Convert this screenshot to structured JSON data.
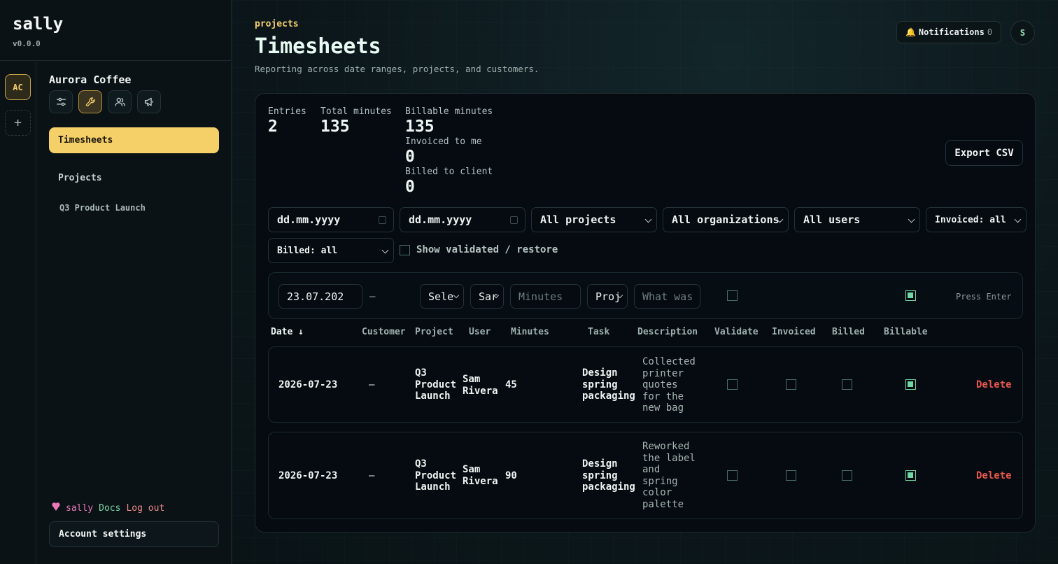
{
  "brand": {
    "name": "sally",
    "version": "v0.0.0"
  },
  "rail": {
    "org_initials": "AC",
    "add_label": "+"
  },
  "sidebar": {
    "org_name": "Aurora Coffee",
    "nav": {
      "timesheets": "Timesheets",
      "projects": "Projects",
      "project_sub": "Q3 Product Launch"
    },
    "footer": {
      "sally": "sally",
      "docs": "Docs",
      "logout": "Log out"
    },
    "account": "Account settings"
  },
  "header": {
    "crumb": "projects",
    "title": "Timesheets",
    "subtitle": "Reporting across date ranges, projects, and customers.",
    "notifications_label": "Notifications",
    "notifications_count": "0",
    "avatar_initial": "S"
  },
  "stats": {
    "entries_label": "Entries",
    "entries_value": "2",
    "total_label": "Total minutes",
    "total_value": "135",
    "billable_label": "Billable minutes",
    "billable_value": "135",
    "invoiced_label": "Invoiced to me",
    "invoiced_value": "0",
    "billed_label": "Billed to client",
    "billed_value": "0"
  },
  "export_label": "Export CSV",
  "filters": {
    "from_date": "dd.mm.yyyy",
    "to_date": "dd.mm.yyyy",
    "project": "All projects",
    "organization": "All organizations",
    "user": "All users",
    "invoiced": "Invoiced: all",
    "billed": "Billed: all",
    "show_validated": "Show validated / restore"
  },
  "entry": {
    "date": "23.07.202",
    "dash": "–",
    "customer": "Sele",
    "user": "Sar",
    "minutes_placeholder": "Minutes",
    "project": "Proj",
    "description_placeholder": "What was",
    "hint": "Press Enter"
  },
  "columns": {
    "date": "Date ↓",
    "customer": "Customer",
    "project": "Project",
    "user": "User",
    "minutes": "Minutes",
    "task": "Task",
    "description": "Description",
    "validate": "Validate",
    "invoiced": "Invoiced",
    "billed": "Billed",
    "billable": "Billable"
  },
  "rows": [
    {
      "date": "2026-07-23",
      "customer": "–",
      "project": [
        "Q3",
        "Product",
        "Launch"
      ],
      "user": [
        "Sam",
        "Rivera"
      ],
      "minutes": "45",
      "task": [
        "Design",
        "spring",
        "packaging"
      ],
      "description": [
        "Collected",
        "printer",
        "quotes",
        "for the",
        "new bag"
      ],
      "delete": "Delete"
    },
    {
      "date": "2026-07-23",
      "customer": "–",
      "project": [
        "Q3",
        "Product",
        "Launch"
      ],
      "user": [
        "Sam",
        "Rivera"
      ],
      "minutes": "90",
      "task": [
        "Design",
        "spring",
        "packaging"
      ],
      "description": [
        "Reworked",
        "the label",
        "and",
        "spring",
        "color",
        "palette"
      ],
      "delete": "Delete"
    }
  ],
  "colors": {
    "accent": "#f5cf68",
    "success": "#6fd7a6",
    "danger": "#e8574e",
    "bg": "#050b10"
  }
}
